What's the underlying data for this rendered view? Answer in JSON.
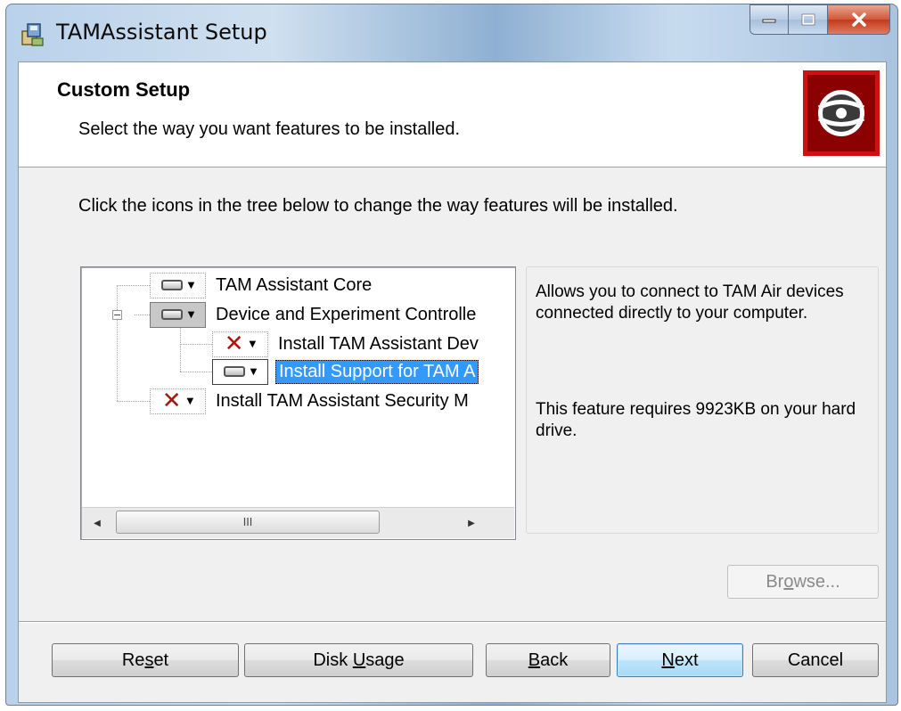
{
  "window": {
    "title": "TAMAssistant Setup",
    "app_icon": "installer-icon",
    "caption_buttons": [
      "minimize-icon",
      "maximize-icon",
      "close-icon"
    ]
  },
  "banner": {
    "title": "Custom Setup",
    "description": "Select the way you want features to be installed.",
    "logo_icon": "disc-icon",
    "logo_color": "#8b0000"
  },
  "instruction": "Click the icons in the tree below to change the way features will be installed.",
  "tree": {
    "items": [
      {
        "label": "TAM Assistant Core",
        "state_icon": "drive-icon"
      },
      {
        "label": "Device and Experiment Controlle",
        "state_icon": "drive-icon"
      },
      {
        "label": "Install TAM Assistant Dev",
        "state_icon": "red-x-icon"
      },
      {
        "label": "Install Support for TAM A",
        "state_icon": "drive-icon",
        "selected": true
      },
      {
        "label": "Install TAM Assistant Security M",
        "state_icon": "red-x-icon"
      }
    ],
    "expander_symbol": "−",
    "scrollbar": {
      "thumb_grip": "III"
    }
  },
  "description_panel": {
    "text": "Allows you to connect to TAM Air devices connected directly to your computer.",
    "size_text": "This feature requires 9923KB on your hard drive."
  },
  "buttons": {
    "browse": {
      "prefix": "Br",
      "accel": "o",
      "suffix": "wse..."
    },
    "reset": {
      "prefix": "Re",
      "accel": "s",
      "suffix": "et"
    },
    "disk_usage": {
      "prefix": "Disk ",
      "accel": "U",
      "suffix": "sage"
    },
    "back": {
      "prefix": "",
      "accel": "B",
      "suffix": "ack"
    },
    "next": {
      "prefix": "",
      "accel": "N",
      "suffix": "ext"
    },
    "cancel": {
      "label": "Cancel"
    }
  }
}
